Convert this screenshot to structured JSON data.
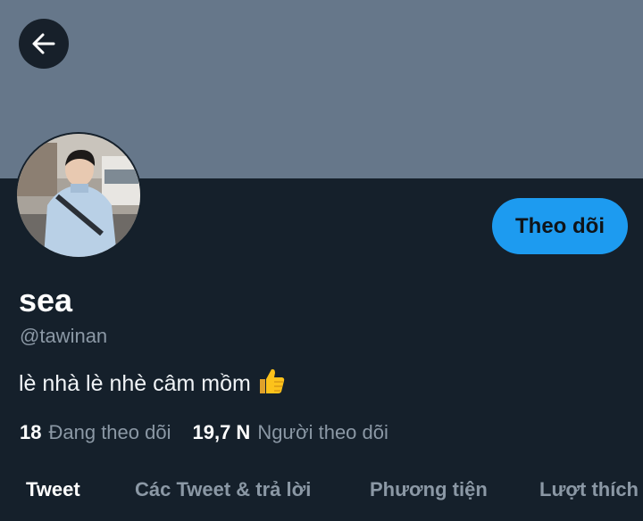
{
  "header": {
    "back_icon": "arrow-left-icon"
  },
  "colors": {
    "banner": "#66778a",
    "background": "#15202b",
    "accent": "#1d9bf0"
  },
  "profile": {
    "name": "sea",
    "handle": "@tawinan",
    "bio": "lè nhà lè nhè câm mồm",
    "bio_emoji": "thumbs-up-icon",
    "follow_label": "Theo dõi"
  },
  "stats": {
    "following_count": "18",
    "following_label": "Đang theo dõi",
    "followers_count": "19,7 N",
    "followers_label": "Người theo dõi"
  },
  "tabs": [
    {
      "label": "Tweet",
      "active": true
    },
    {
      "label": "Các Tweet & trả lời",
      "active": false
    },
    {
      "label": "Phương tiện",
      "active": false
    },
    {
      "label": "Lượt thích",
      "active": false
    }
  ]
}
